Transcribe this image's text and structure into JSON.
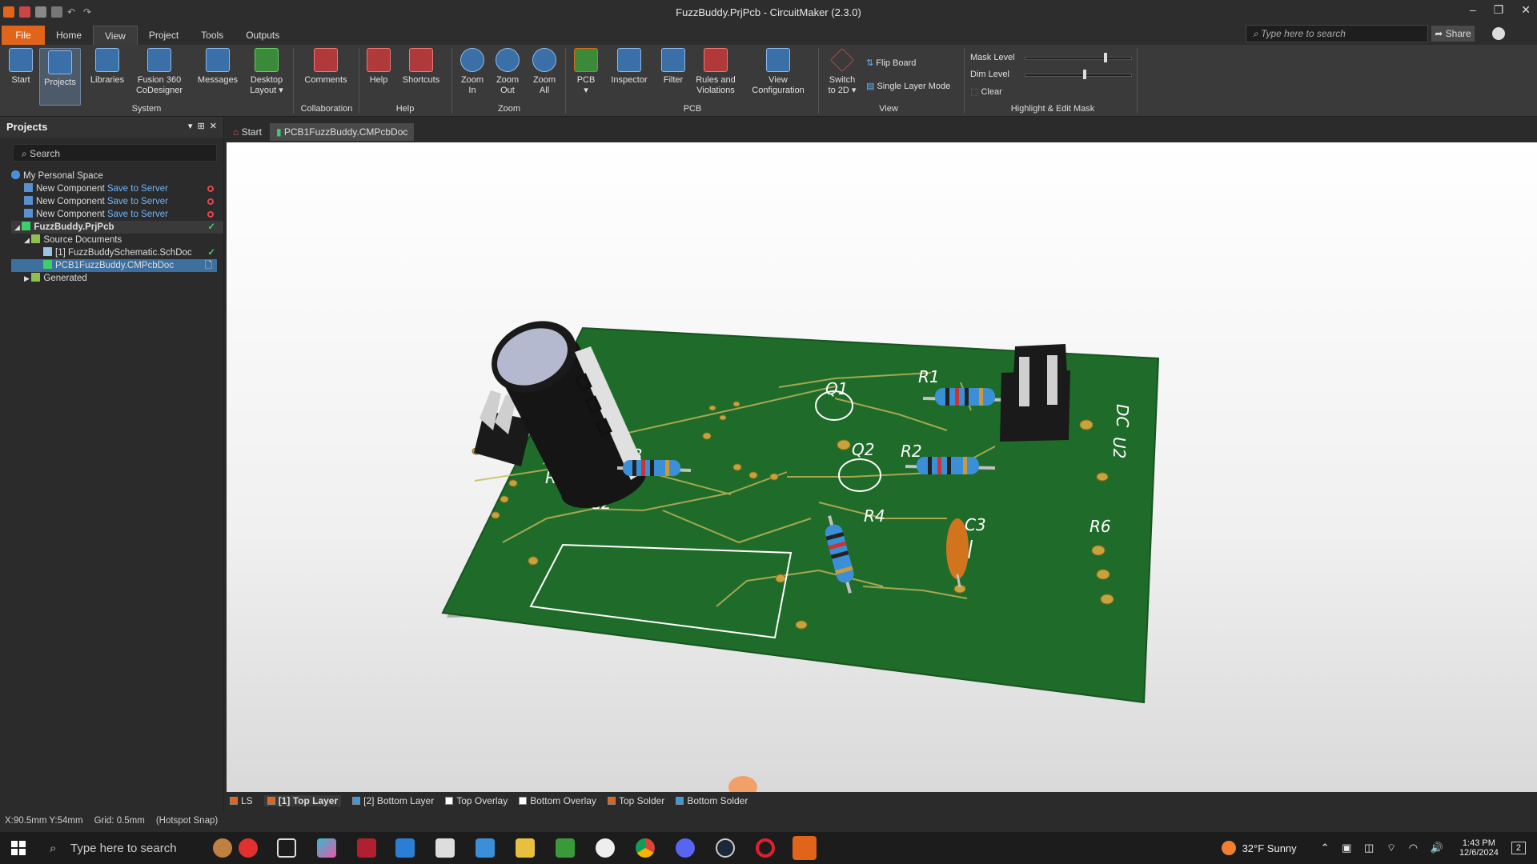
{
  "app": {
    "title": "FuzzBuddy.PrjPcb - CircuitMaker (2.3.0)"
  },
  "menu": {
    "tabs": [
      "File",
      "Home",
      "View",
      "Project",
      "Tools",
      "Outputs"
    ],
    "search_placeholder": "Type here to search",
    "share": "Share"
  },
  "ribbon": {
    "buttons": [
      {
        "id": "start",
        "label": "Start"
      },
      {
        "id": "projects",
        "label": "Projects"
      },
      {
        "id": "libraries",
        "label": "Libraries"
      },
      {
        "id": "fusion",
        "label": "Fusion 360\nCoDesigner"
      },
      {
        "id": "messages",
        "label": "Messages"
      },
      {
        "id": "desktop",
        "label": "Desktop\nLayout ▾"
      },
      {
        "id": "comments",
        "label": "Comments"
      },
      {
        "id": "help",
        "label": "Help"
      },
      {
        "id": "shortcuts",
        "label": "Shortcuts"
      },
      {
        "id": "zoomin",
        "label": "Zoom\nIn"
      },
      {
        "id": "zoomout",
        "label": "Zoom\nOut"
      },
      {
        "id": "zoomall",
        "label": "Zoom\nAll"
      },
      {
        "id": "pcb",
        "label": "PCB\n▾"
      },
      {
        "id": "inspector",
        "label": "Inspector"
      },
      {
        "id": "filter",
        "label": "Filter"
      },
      {
        "id": "rules",
        "label": "Rules and\nViolations"
      },
      {
        "id": "viewcfg",
        "label": "View\nConfiguration"
      },
      {
        "id": "switch2d",
        "label": "Switch\nto 2D ▾"
      }
    ],
    "view_small": [
      "Flip Board",
      "Single Layer Mode"
    ],
    "mask": {
      "mask_level": "Mask Level",
      "dim_level": "Dim Level",
      "clear": "Clear",
      "mask_value": 0.75,
      "dim_value": 0.55
    },
    "groups": [
      "System",
      "Collaboration",
      "Help",
      "Zoom",
      "PCB",
      "View",
      "Highlight & Edit Mask"
    ]
  },
  "panel": {
    "title": "Projects",
    "search": "Search",
    "tree": {
      "root": "My Personal Space",
      "component": "New Component",
      "save": "Save to Server",
      "project": "FuzzBuddy.PrjPcb",
      "source": "Source Documents",
      "schematic": "[1] FuzzBuddySchematic.SchDoc",
      "pcbdoc": "PCB1FuzzBuddy.CMPcbDoc",
      "generated": "Generated"
    }
  },
  "doctabs": {
    "start": "Start",
    "pcb": "PCB1FuzzBuddy.CMPcbDoc"
  },
  "board": {
    "labels": [
      "Q1",
      "R1",
      "DC",
      "U2",
      "Q2",
      "R2",
      "R3",
      "R5",
      "C2",
      "R4",
      "C3",
      "R6"
    ]
  },
  "layers": [
    "LS",
    "[1] Top Layer",
    "[2] Bottom Layer",
    "Top Overlay",
    "Bottom Overlay",
    "Top Solder",
    "Bottom Solder"
  ],
  "layer_colors": [
    "#e0651b",
    "#e0651b",
    "#3a9bd8",
    "#ffffff",
    "#ffffff",
    "#e0651b",
    "#3a9bd8"
  ],
  "status": {
    "coords": "X:90.5mm Y:54mm",
    "grid": "Grid: 0.5mm",
    "snap": "(Hotspot Snap)"
  },
  "taskbar": {
    "search": "Type here to search",
    "weather": "32°F  Sunny",
    "time": "1:43 PM",
    "date": "12/6/2024",
    "notif": "2"
  }
}
